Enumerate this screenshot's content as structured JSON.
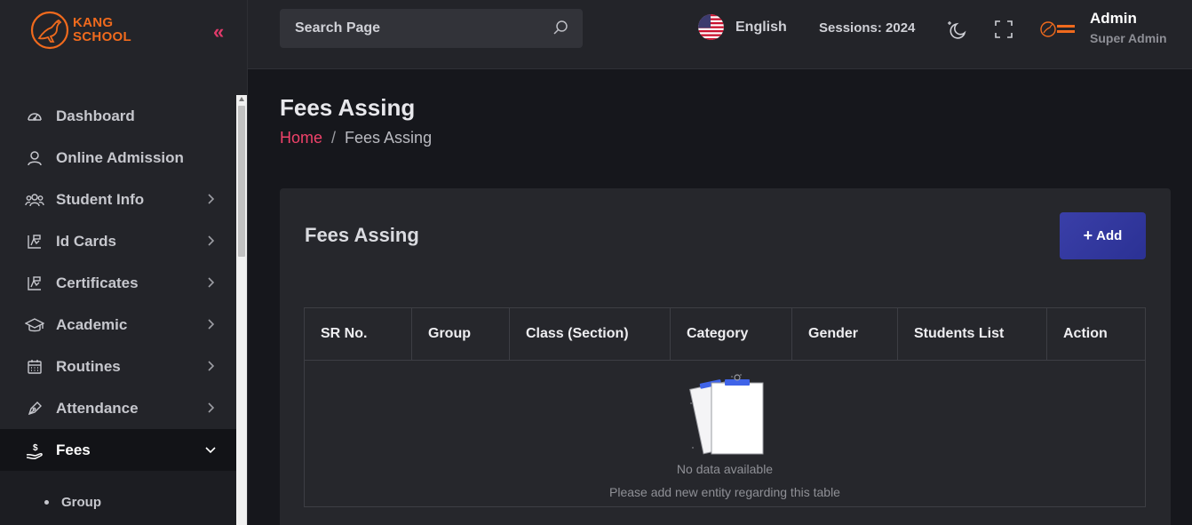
{
  "brand": {
    "line1": "KANG",
    "line2": "SCHOOL",
    "color": "#f06a1d"
  },
  "sidebar": {
    "collapse_glyph": "«",
    "items": [
      {
        "label": "Dashboard",
        "icon": "dashboard-icon",
        "has_children": false
      },
      {
        "label": "Online Admission",
        "icon": "user-icon",
        "has_children": false
      },
      {
        "label": "Student Info",
        "icon": "students-icon",
        "has_children": true
      },
      {
        "label": "Id Cards",
        "icon": "id-card-icon",
        "has_children": true
      },
      {
        "label": "Certificates",
        "icon": "certificate-icon",
        "has_children": true
      },
      {
        "label": "Academic",
        "icon": "graduation-cap-icon",
        "has_children": true
      },
      {
        "label": "Routines",
        "icon": "calendar-icon",
        "has_children": true
      },
      {
        "label": "Attendance",
        "icon": "pen-icon",
        "has_children": true
      },
      {
        "label": "Fees",
        "icon": "fees-icon",
        "has_children": true,
        "active": true
      }
    ],
    "fees_submenu": [
      {
        "label": "Group"
      }
    ]
  },
  "header": {
    "search_placeholder": "Search Page",
    "language": "English",
    "sessions": "Sessions: 2024",
    "user": {
      "name": "Admin",
      "role": "Super Admin"
    }
  },
  "page": {
    "title": "Fees Assing",
    "breadcrumb": {
      "home": "Home",
      "separator": "/",
      "current": "Fees Assing"
    }
  },
  "card": {
    "title": "Fees Assing",
    "add_button": "Add",
    "columns": [
      "SR No.",
      "Group",
      "Class (Section)",
      "Category",
      "Gender",
      "Students List",
      "Action"
    ],
    "empty_title": "No data available",
    "empty_subtitle": "Please add new entity regarding this table"
  },
  "colors": {
    "accent": "#f0426a",
    "primary_button": "#3a3fa8",
    "sidebar_bg": "#232429",
    "page_bg": "#16171c"
  }
}
